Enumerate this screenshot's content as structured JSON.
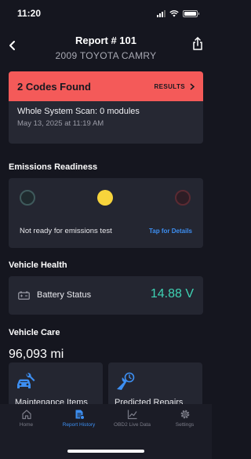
{
  "status_bar": {
    "time": "11:20"
  },
  "header": {
    "title": "Report # 101",
    "subtitle": "2009 TOYOTA CAMRY"
  },
  "codes": {
    "title": "2 Codes Found",
    "results_label": "RESULTS",
    "scan_title": "Whole System Scan: 0 modules",
    "scan_date": "May 13, 2025 at 11:19 AM",
    "banner_color": "#f45a59"
  },
  "emissions": {
    "section_title": "Emissions Readiness",
    "status": "Not ready for emissions test",
    "details_link": "Tap for Details"
  },
  "vehicle_health": {
    "section_title": "Vehicle Health",
    "battery_label": "Battery Status",
    "battery_value": "14.88 V",
    "value_color": "#3fd3b4"
  },
  "vehicle_care": {
    "section_title": "Vehicle Care",
    "mileage": "96,093 mi",
    "tiles": [
      {
        "label": "Maintenance Items",
        "icon": "car-wrench-icon"
      },
      {
        "label": "Predicted Repairs",
        "icon": "wrench-clock-icon"
      }
    ]
  },
  "tabs": [
    {
      "label": "Home",
      "icon": "home-icon",
      "active": false
    },
    {
      "label": "Report History",
      "icon": "report-icon",
      "active": true
    },
    {
      "label": "OBD2 Live Data",
      "icon": "chart-icon",
      "active": false
    },
    {
      "label": "Settings",
      "icon": "gear-icon",
      "active": false
    }
  ],
  "accent_color": "#3d8ff2"
}
